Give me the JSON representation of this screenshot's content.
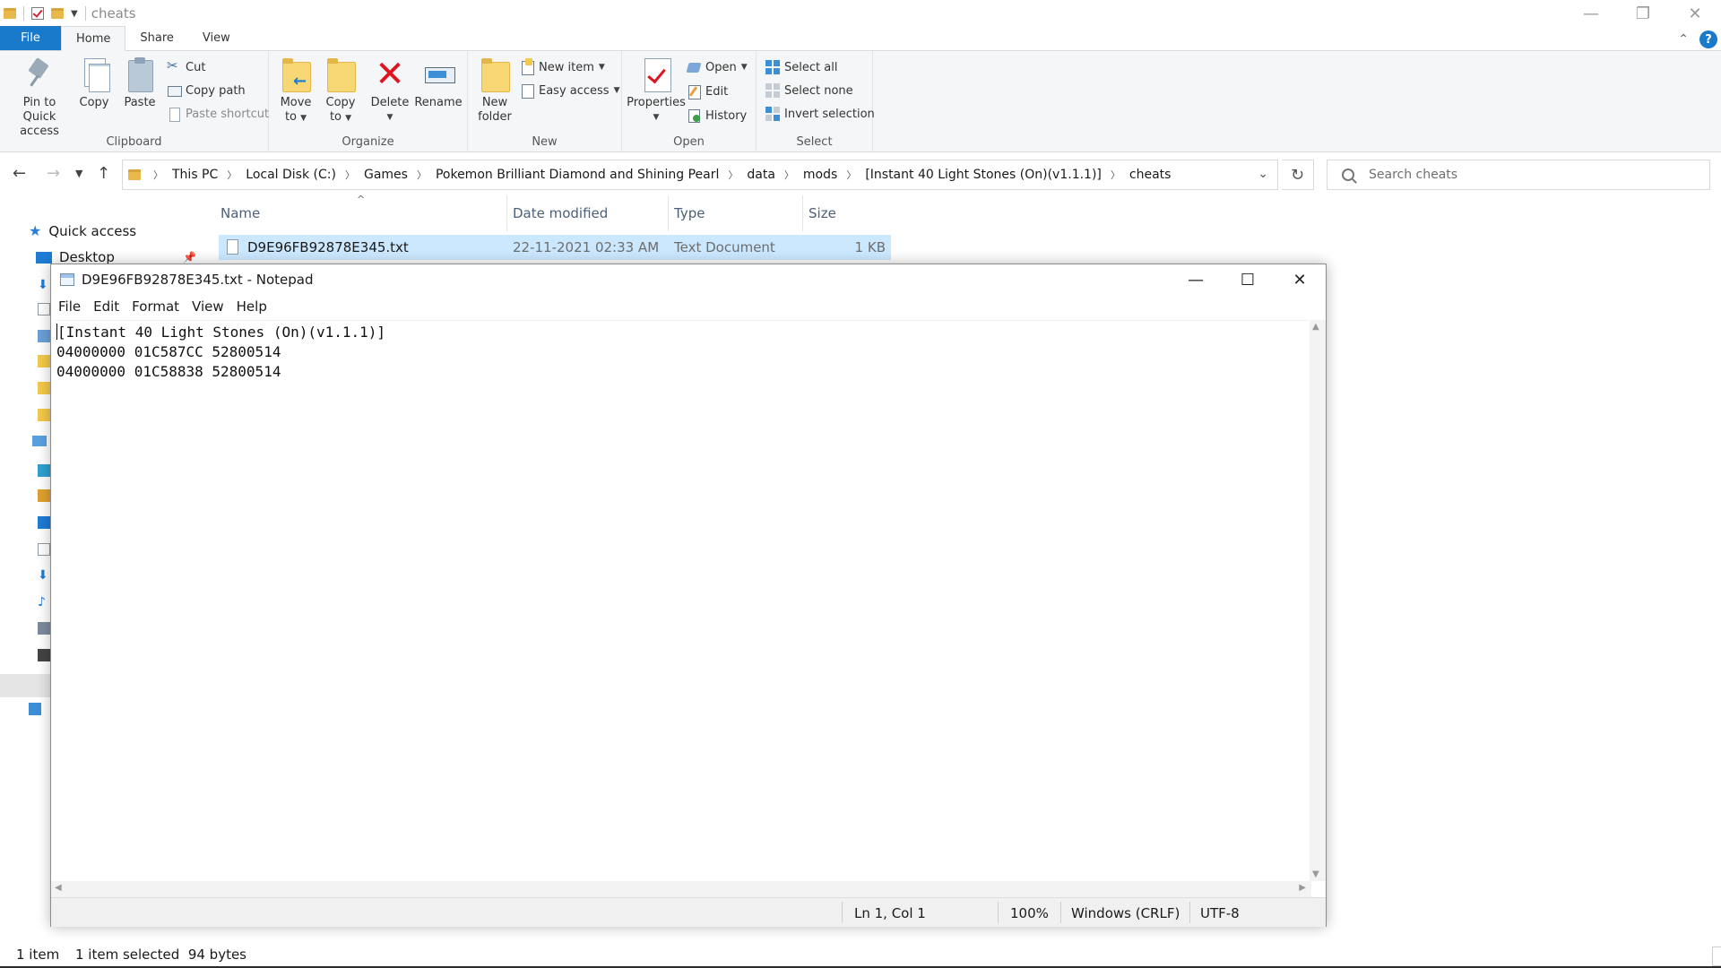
{
  "window": {
    "title": "cheats",
    "controls": [
      "minimize-icon",
      "restore-icon",
      "close-icon"
    ]
  },
  "ribbon": {
    "tabs": [
      "File",
      "Home",
      "Share",
      "View"
    ],
    "active_tab": "Home",
    "clipboard": {
      "label": "Clipboard",
      "pin_line1": "Pin to Quick",
      "pin_line2": "access",
      "copy": "Copy",
      "paste": "Paste",
      "cut": "Cut",
      "copy_path": "Copy path",
      "paste_shortcut": "Paste shortcut"
    },
    "organize": {
      "label": "Organize",
      "move_line1": "Move",
      "move_line2": "to",
      "copy_line1": "Copy",
      "copy_line2": "to",
      "delete": "Delete",
      "rename": "Rename"
    },
    "new": {
      "label": "New",
      "folder_line1": "New",
      "folder_line2": "folder",
      "new_item": "New item",
      "easy_access": "Easy access"
    },
    "open": {
      "label": "Open",
      "properties": "Properties",
      "open": "Open",
      "edit": "Edit",
      "history": "History"
    },
    "select": {
      "label": "Select",
      "select_all": "Select all",
      "select_none": "Select none",
      "invert": "Invert selection"
    }
  },
  "address": {
    "breadcrumbs": [
      "This PC",
      "Local Disk (C:)",
      "Games",
      "Pokemon Brilliant Diamond and Shining Pearl",
      "data",
      "mods",
      "[Instant 40 Light Stones (On)(v1.1.1)]",
      "cheats"
    ],
    "search_placeholder": "Search cheats"
  },
  "nav": {
    "quick_access": "Quick access",
    "desktop": "Desktop"
  },
  "filelist": {
    "columns": [
      "Name",
      "Date modified",
      "Type",
      "Size"
    ],
    "rows": [
      {
        "name": "D9E96FB92878E345.txt",
        "date": "22-11-2021 02:33 AM",
        "type": "Text Document",
        "size": "1 KB"
      }
    ]
  },
  "notepad": {
    "title": "D9E96FB92878E345.txt - Notepad",
    "menu": [
      "File",
      "Edit",
      "Format",
      "View",
      "Help"
    ],
    "lines": [
      "[Instant 40 Light Stones (On)(v1.1.1)]",
      "04000000 01C587CC 52800514",
      "04000000 01C58838 52800514"
    ],
    "status": {
      "position": "Ln 1, Col 1",
      "zoom": "100%",
      "line_ending": "Windows (CRLF)",
      "encoding": "UTF-8"
    }
  },
  "statusbar": {
    "item_count": "1 item",
    "selection": "1 item selected  94 bytes"
  },
  "colors": {
    "file_tab": "#1979ca",
    "selection": "#cce8ff",
    "delete_icon": "#e0141e"
  }
}
